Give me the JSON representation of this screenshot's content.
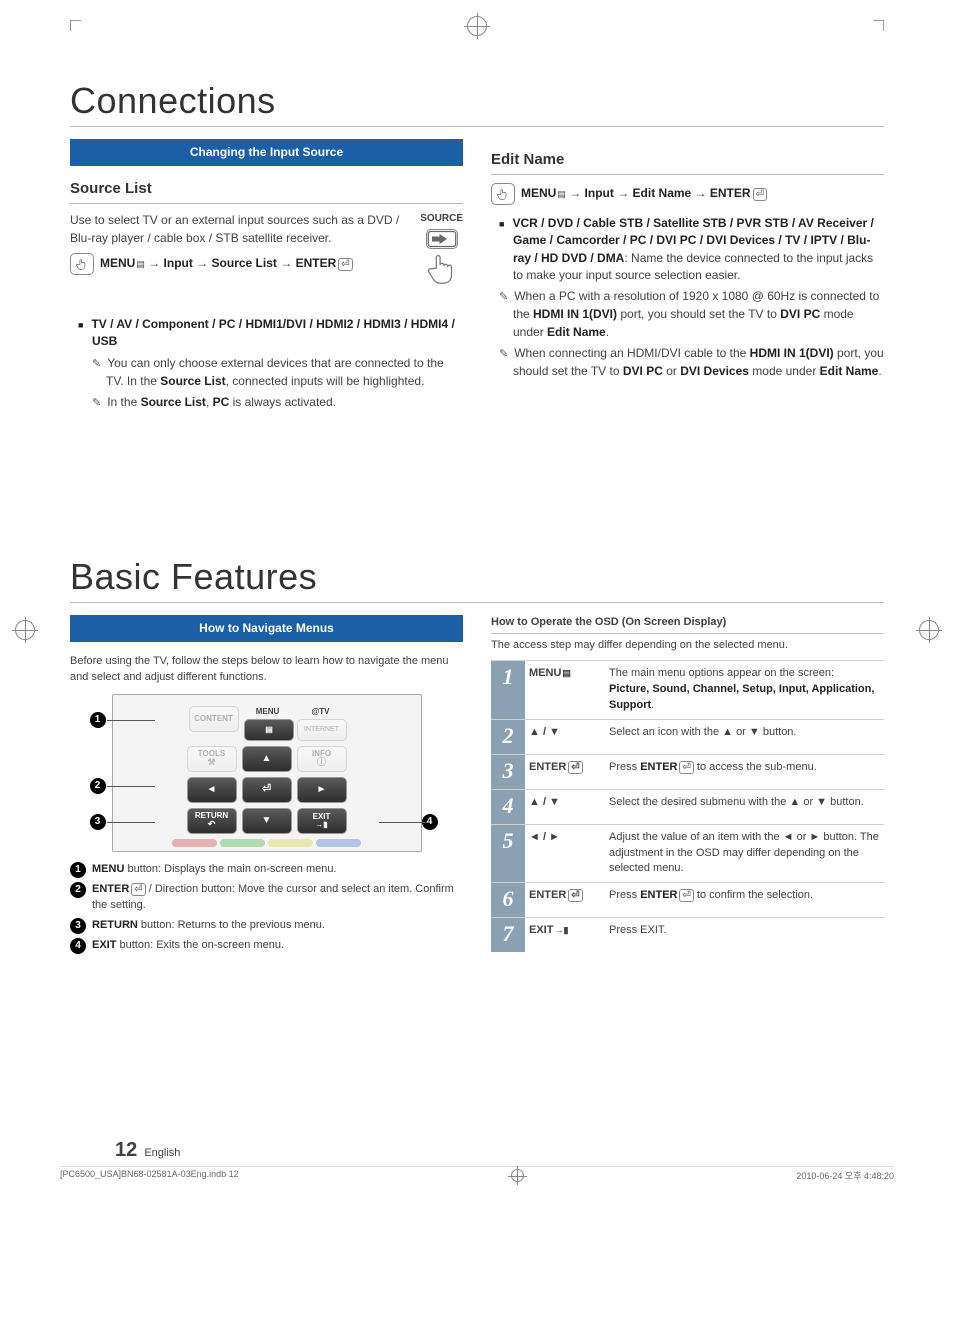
{
  "meta": {
    "page_number": "12",
    "language": "English",
    "file_stamp_left": "[PC6500_USA]BN68-02581A-03Eng.indb   12",
    "file_stamp_right": "2010-06-24   오후 4:48:20"
  },
  "section1": {
    "title": "Connections",
    "banner": "Changing the Input Source",
    "source_list_heading": "Source List",
    "source_list_text": "Use to select TV or an external input sources such as a DVD / Blu-ray player / cable box / STB satellite receiver.",
    "source_btn_label": "SOURCE",
    "menu_path_1_a": "MENU",
    "menu_path_1_b": "Input",
    "menu_path_1_c": "Source List",
    "menu_path_1_d": "ENTER",
    "inputs_bold": "TV / AV / Component / PC / HDMI1/DVI / HDMI2 / HDMI3 / HDMI4 / USB",
    "note1": "You can only choose external devices that are connected to the TV. In the Source List, connected inputs will be highlighted.",
    "note1_bold": "Source List",
    "note2_pre": "In the ",
    "note2_b1": "Source List",
    "note2_mid": ", ",
    "note2_b2": "PC",
    "note2_post": " is always activated.",
    "edit_heading": "Edit Name",
    "edit_path_a": "MENU",
    "edit_path_b": "Input",
    "edit_path_c": "Edit Name",
    "edit_path_d": "ENTER",
    "edit_devices_bold": "VCR / DVD / Cable STB / Satellite STB / PVR STB / AV Receiver / Game / Camcorder / PC / DVI PC / DVI Devices / TV / IPTV / Blu-ray / HD DVD / DMA",
    "edit_devices_rest": ": Name the device connected to the input jacks to make your input source selection easier.",
    "edit_note1_pre": "When a PC with a resolution of 1920 x 1080 @ 60Hz is connected to the ",
    "edit_note1_b1": "HDMI IN 1(DVI)",
    "edit_note1_mid": " port, you should set the TV to ",
    "edit_note1_b2": "DVI PC",
    "edit_note1_mid2": " mode under ",
    "edit_note1_b3": "Edit Name",
    "edit_note1_end": ".",
    "edit_note2_pre": "When connecting an HDMI/DVI cable to the ",
    "edit_note2_b1": "HDMI IN 1(DVI)",
    "edit_note2_mid": " port, you should set the TV to ",
    "edit_note2_b2": "DVI PC",
    "edit_note2_or": " or ",
    "edit_note2_b3": "DVI Devices",
    "edit_note2_mid2": " mode under ",
    "edit_note2_b4": "Edit Name",
    "edit_note2_end": "."
  },
  "section2": {
    "title": "Basic Features",
    "banner": "How to Navigate Menus",
    "intro": "Before using the TV, follow the steps below to learn how to navigate the menu and select and adjust different functions.",
    "remote": {
      "row_top": {
        "content": "CONTENT",
        "menu": "MENU",
        "atv": "@TV",
        "internet": "INTERNET"
      },
      "row_mid": {
        "tools": "TOOLS",
        "info": "INFO",
        "return": "RETURN",
        "exit": "EXIT"
      },
      "callout1": "1",
      "callout2": "2",
      "callout3": "3",
      "callout4": "4"
    },
    "legend": [
      {
        "n": "1",
        "bold": "MENU",
        "rest": " button: Displays the main on-screen menu."
      },
      {
        "n": "2",
        "bold": "ENTER",
        "icon": "enter",
        "rest": " / Direction button: Move the cursor and select an item. Confirm the setting."
      },
      {
        "n": "3",
        "bold": "RETURN",
        "rest": " button: Returns to the previous menu."
      },
      {
        "n": "4",
        "bold": "EXIT",
        "rest": " button: Exits the on-screen menu."
      }
    ],
    "osd_heading": "How to Operate the OSD (On Screen Display)",
    "osd_subtext": "The access step may differ depending on the selected menu.",
    "osd_steps": [
      {
        "n": "1",
        "key": "MENU",
        "key_icon": "menu",
        "desc_pre": "The main menu options appear on the screen:",
        "desc_bold": "Picture, Sound, Channel, Setup, Input, Application, Support",
        "desc_after": "."
      },
      {
        "n": "2",
        "key": "▲ / ▼",
        "desc": "Select an icon with the ▲ or ▼ button."
      },
      {
        "n": "3",
        "key": "ENTER",
        "key_icon": "enter",
        "desc_pre": "Press ",
        "desc_bold": "ENTER",
        "desc_icon": "enter",
        "desc_after": " to access the sub-menu."
      },
      {
        "n": "4",
        "key": "▲ / ▼",
        "desc": "Select the desired submenu with the ▲ or ▼ button."
      },
      {
        "n": "5",
        "key": "◄ / ►",
        "desc": "Adjust the value of an item with the ◄ or ► button. The adjustment in the OSD may differ depending on the selected menu."
      },
      {
        "n": "6",
        "key": "ENTER",
        "key_icon": "enter",
        "desc_pre": "Press ",
        "desc_bold": "ENTER",
        "desc_icon": "enter",
        "desc_after": " to confirm the selection."
      },
      {
        "n": "7",
        "key": "EXIT",
        "key_icon": "exit",
        "desc": "Press EXIT."
      }
    ]
  }
}
